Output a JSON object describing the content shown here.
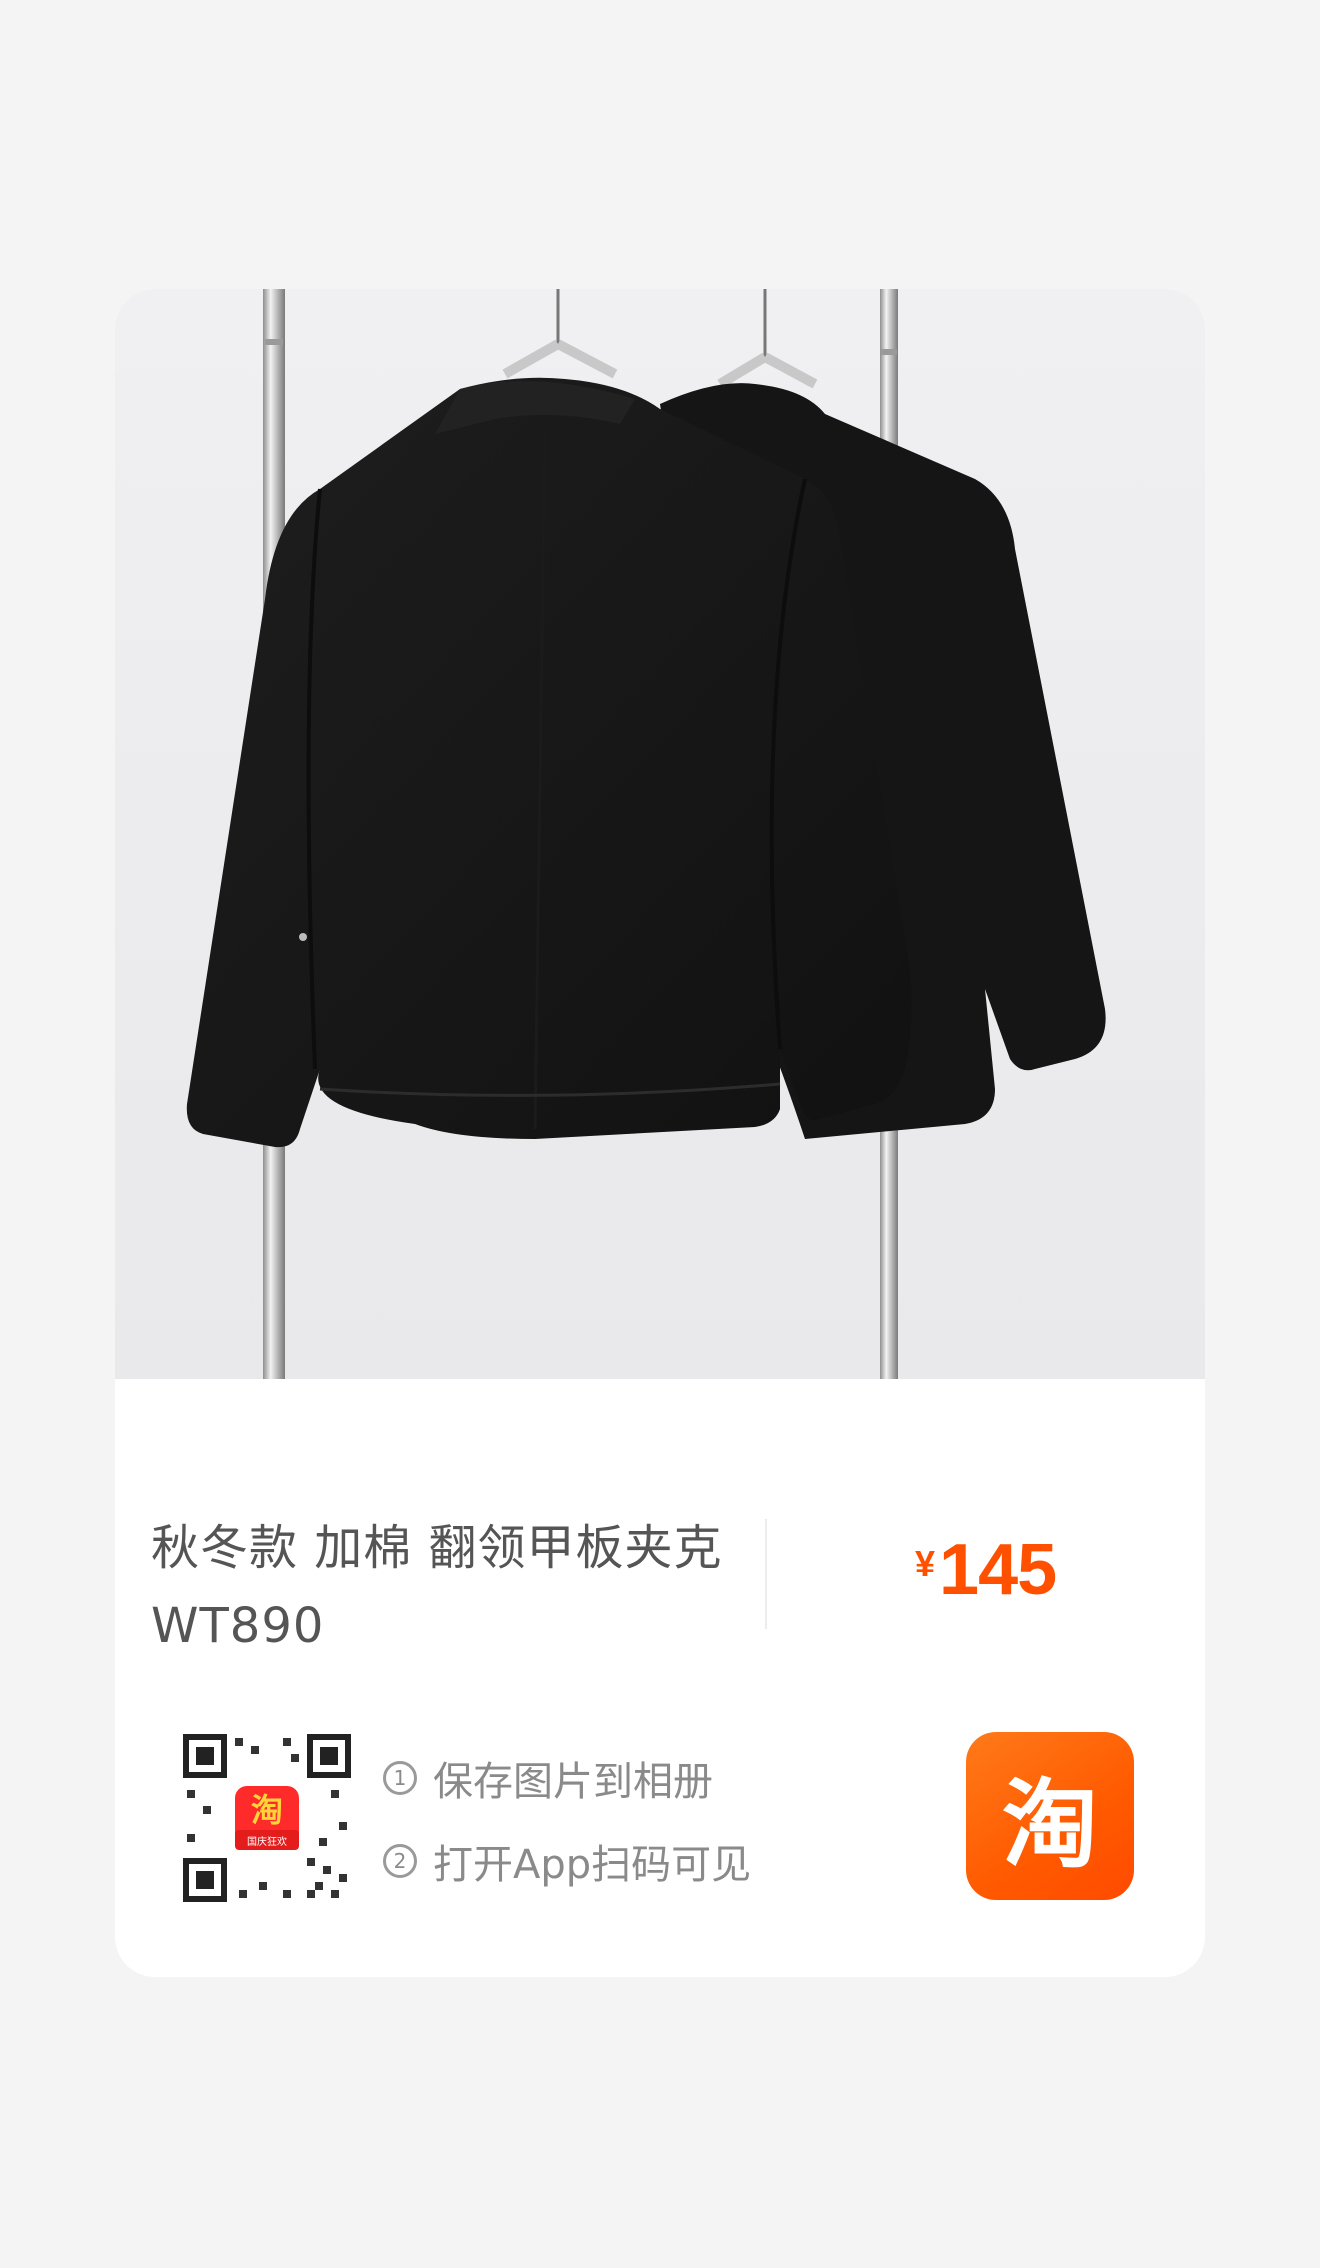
{
  "product": {
    "title_line1": "秋冬款 加棉 翻领甲板夹克",
    "title_line2": "WT890",
    "currency_symbol": "¥",
    "price": "145"
  },
  "qr": {
    "badge_char": "淘",
    "badge_caption": "国庆狂欢"
  },
  "tips": [
    {
      "index": "1",
      "text": "保存图片到相册"
    },
    {
      "index": "2",
      "text": "打开App扫码可见"
    }
  ],
  "app_logo": {
    "glyph": "淘"
  },
  "colors": {
    "price": "#ff5000",
    "logo_bg": "#ff5a00",
    "page_bg": "#f4f4f4",
    "card_bg": "#ffffff"
  }
}
